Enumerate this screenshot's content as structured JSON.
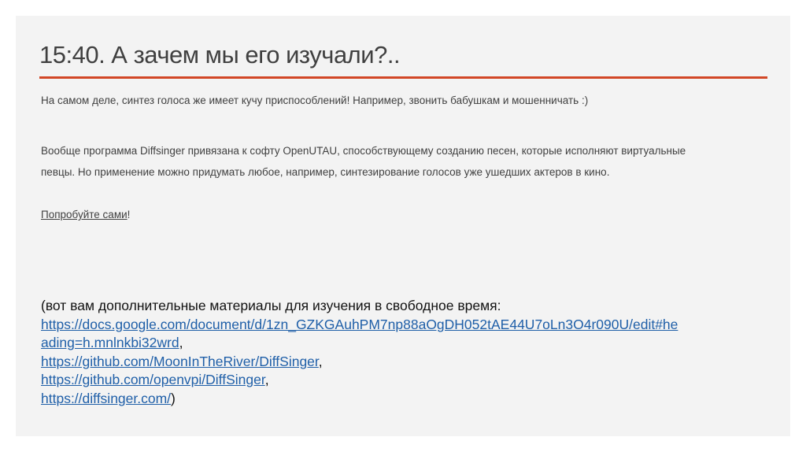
{
  "title": "15:40. А зачем мы его изучали?..",
  "accent_color": "#d24726",
  "para1": "На самом деле, синтез голоса же имеет кучу приспособлений! Например, звонить бабушкам и мошенничать :)",
  "para2_line1": "Вообще программа Diffsinger привязана к софту OpenUTAU, способствующему созданию песен, которые исполняют виртуальные",
  "para2_line2": "певцы. Но применение можно придумать любое, например, синтезирование голосов уже ушедших актеров в кино.",
  "try_link": "Попробуйте сами",
  "try_suffix": "!",
  "materials_intro": "(вот вам дополнительные материалы для изучения в свободное время:",
  "links": [
    {
      "line1": "https://docs.google.com/document/d/1zn_GZKGAuhPM7np88aOgDH052tAE44U7oLn3O4r090U/edit#he",
      "line2": "ading=h.mnlnkbi32wrd",
      "suffix": ","
    },
    {
      "text": "https://github.com/MoonInTheRiver/DiffSinger",
      "suffix": ","
    },
    {
      "text": "https://github.com/openvpi/DiffSinger",
      "suffix": ","
    },
    {
      "text": "https://diffsinger.com/",
      "suffix": ")"
    }
  ]
}
